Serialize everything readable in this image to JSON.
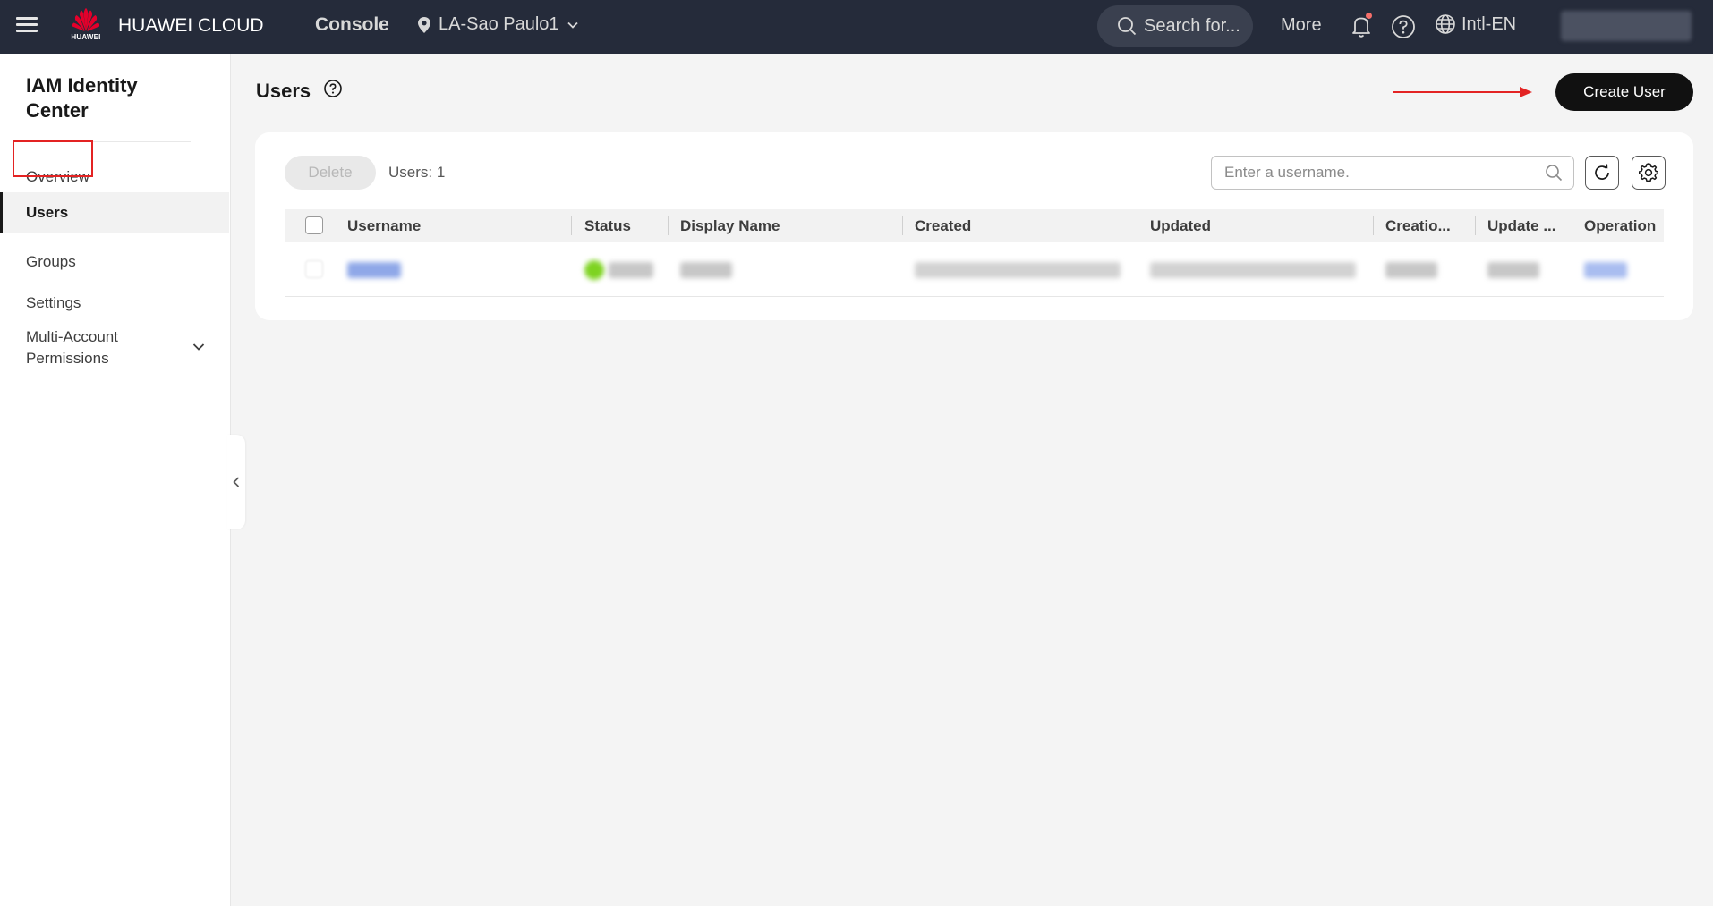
{
  "topbar": {
    "brand": "HUAWEI CLOUD",
    "logo_text": "HUAWEI",
    "console": "Console",
    "region": "LA-Sao Paulo1",
    "search_placeholder": "Search for...",
    "more": "More",
    "language": "Intl-EN"
  },
  "sidebar": {
    "title": "IAM Identity Center",
    "items": [
      {
        "label": "Overview"
      },
      {
        "label": "Users"
      },
      {
        "label": "Groups"
      },
      {
        "label": "Settings"
      },
      {
        "label": "Multi-Account Permissions"
      }
    ]
  },
  "main": {
    "title": "Users",
    "create_button": "Create User",
    "delete_button": "Delete",
    "users_count": "Users: 1",
    "search_placeholder": "Enter a username.",
    "table": {
      "columns": [
        "Username",
        "Status",
        "Display Name",
        "Created",
        "Updated",
        "Creatio...",
        "Update ...",
        "Operation"
      ],
      "rows": [
        {
          "username": "",
          "status": "",
          "display_name": "",
          "created": "",
          "updated": "",
          "creation_source": "",
          "update_source": "",
          "operation": ""
        }
      ]
    }
  },
  "colors": {
    "topbar_bg": "#252b3a",
    "accent_dark": "#111111",
    "highlight_red": "#e32323",
    "link_blue": "#526ecc",
    "status_green": "#7ed321"
  }
}
